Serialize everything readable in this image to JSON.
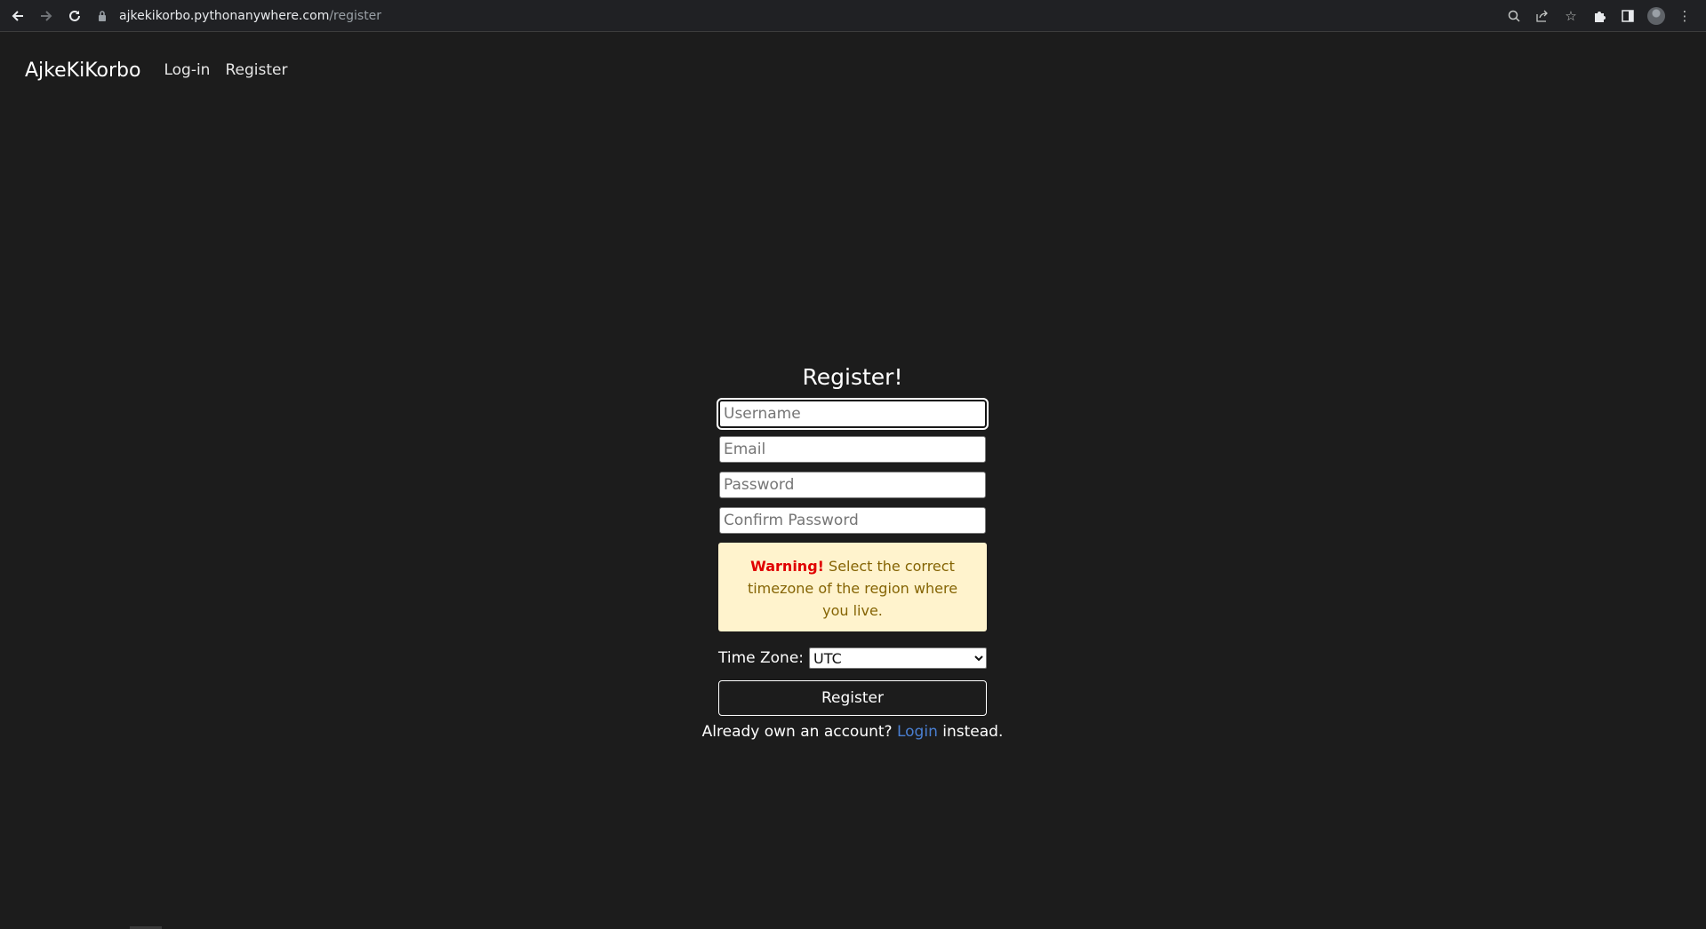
{
  "browser": {
    "url_host": "ajkekikorbo.pythonanywhere.com",
    "url_path": "/register",
    "icons": [
      "back-icon",
      "forward-icon",
      "reload-icon",
      "lock-icon",
      "zoom-icon",
      "share-icon",
      "bookmark-star-icon",
      "extensions-icon",
      "side-panel-icon",
      "profile-avatar",
      "menu-dots-icon"
    ]
  },
  "navbar": {
    "brand": "AjkeKiKorbo",
    "links": [
      {
        "label": "Log-in"
      },
      {
        "label": "Register"
      }
    ]
  },
  "form": {
    "title": "Register!",
    "fields": {
      "username_placeholder": "Username",
      "email_placeholder": "Email",
      "password_placeholder": "Password",
      "confirm_placeholder": "Confirm Password"
    },
    "warning": {
      "strong": "Warning!",
      "text": "Select the correct timezone of the region where you live."
    },
    "timezone": {
      "label": "Time Zone:",
      "selected": "UTC"
    },
    "submit_label": "Register",
    "footer": {
      "prefix": "Already own an account?",
      "link": "Login",
      "suffix": "instead."
    }
  },
  "colors": {
    "page_bg": "#1c1c1c",
    "warning_bg": "#fff3cd",
    "warning_text": "#856404",
    "warning_strong": "#e00000",
    "link": "#4a7fd1"
  }
}
